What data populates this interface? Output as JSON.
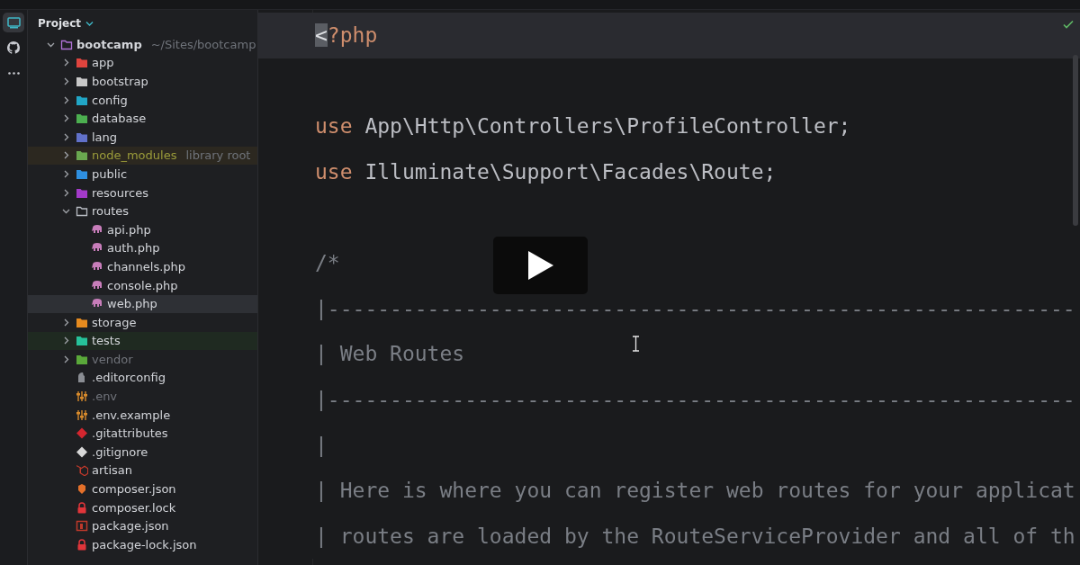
{
  "toolbar": [
    {
      "kind": "monitor",
      "selected": true
    },
    {
      "kind": "github",
      "selected": false
    },
    {
      "kind": "more",
      "selected": false
    }
  ],
  "sidebar": {
    "title": "Project",
    "tree": [
      {
        "label": "bootcamp",
        "path": "~/Sites/bootcamp",
        "kind": "folder-outline",
        "color": "#b072d6",
        "expanded": true,
        "selected": false,
        "children": [
          {
            "label": "app",
            "kind": "folder",
            "color": "#e0443e",
            "expanded": false,
            "selected": false
          },
          {
            "label": "bootstrap",
            "kind": "folder",
            "color": "#c8c8c8",
            "expanded": false,
            "selected": false
          },
          {
            "label": "config",
            "kind": "folder",
            "color": "#21a6c6",
            "expanded": false,
            "selected": false
          },
          {
            "label": "database",
            "kind": "folder",
            "color": "#4caf50",
            "expanded": false,
            "selected": false
          },
          {
            "label": "lang",
            "kind": "folder",
            "color": "#6171c9",
            "expanded": false,
            "selected": false
          },
          {
            "label": "node_modules",
            "note": "library root",
            "kind": "library-folder",
            "color": "#6aa84f",
            "expanded": false,
            "selected": false
          },
          {
            "label": "public",
            "kind": "folder",
            "color": "#2e8fe0",
            "expanded": false,
            "selected": false
          },
          {
            "label": "resources",
            "kind": "folder",
            "color": "#a33ac9",
            "expanded": false,
            "selected": false
          },
          {
            "label": "routes",
            "kind": "folder-outline",
            "color": "#b8bcc4",
            "expanded": true,
            "selected": false,
            "children": [
              {
                "label": "api.php",
                "kind": "php",
                "color": "#c77dba",
                "selected": false
              },
              {
                "label": "auth.php",
                "kind": "php",
                "color": "#c77dba",
                "selected": false
              },
              {
                "label": "channels.php",
                "kind": "php",
                "color": "#c77dba",
                "selected": false
              },
              {
                "label": "console.php",
                "kind": "php",
                "color": "#c77dba",
                "selected": false
              },
              {
                "label": "web.php",
                "kind": "php",
                "color": "#c77dba",
                "selected": true
              }
            ]
          },
          {
            "label": "storage",
            "kind": "folder",
            "color": "#e68a1f",
            "expanded": false,
            "selected": false
          },
          {
            "label": "tests",
            "kind": "test-folder",
            "color": "#26c29a",
            "expanded": false,
            "selected": false
          },
          {
            "label": "vendor",
            "kind": "excluded-folder",
            "color": "#5aa83a",
            "expanded": false,
            "selected": false
          },
          {
            "label": ".editorconfig",
            "kind": "config-file",
            "color": "#8a8d93",
            "selected": false
          },
          {
            "label": ".env",
            "kind": "ignored-env",
            "color": "#d98b2b",
            "selected": false
          },
          {
            "label": ".env.example",
            "kind": "env",
            "color": "#d98b2b",
            "selected": false
          },
          {
            "label": ".gitattributes",
            "kind": "git",
            "color": "#d4262f",
            "selected": false
          },
          {
            "label": ".gitignore",
            "kind": "git",
            "color": "#d8d8d8",
            "selected": false
          },
          {
            "label": "artisan",
            "kind": "laravel",
            "color": "#c0392b",
            "selected": false
          },
          {
            "label": "composer.json",
            "kind": "composer",
            "color": "#e4702a",
            "selected": false
          },
          {
            "label": "composer.lock",
            "kind": "lock",
            "color": "#e0353a",
            "selected": false
          },
          {
            "label": "package.json",
            "kind": "npm",
            "color": "#c0392b",
            "selected": false
          },
          {
            "label": "package-lock.json",
            "kind": "lock",
            "color": "#e0353a",
            "selected": false
          }
        ]
      }
    ]
  },
  "editor": {
    "lines": [
      {
        "current": true,
        "tokens": [
          {
            "kind": "caret",
            "text": "<"
          },
          {
            "kind": "keyword",
            "text": "?php"
          }
        ]
      },
      {
        "current": false
      },
      {
        "current": false,
        "tokens": [
          {
            "kind": "keyword",
            "text": "use"
          },
          {
            "kind": "plain",
            "text": " App\\Http\\Controllers\\ProfileController;"
          }
        ]
      },
      {
        "current": false,
        "tokens": [
          {
            "kind": "keyword",
            "text": "use"
          },
          {
            "kind": "plain",
            "text": " Illuminate\\Support\\Facades\\Route;"
          }
        ]
      },
      {
        "current": false
      },
      {
        "current": false,
        "tokens": [
          {
            "kind": "comment",
            "text": "/*"
          }
        ]
      },
      {
        "current": false,
        "tokens": [
          {
            "kind": "comment",
            "text": "|------------------------------------------------------------"
          }
        ]
      },
      {
        "current": false,
        "tokens": [
          {
            "kind": "comment",
            "text": "| Web Routes"
          }
        ]
      },
      {
        "current": false,
        "tokens": [
          {
            "kind": "comment",
            "text": "|------------------------------------------------------------"
          }
        ]
      },
      {
        "current": false,
        "tokens": [
          {
            "kind": "comment",
            "text": "|"
          }
        ]
      },
      {
        "current": false,
        "tokens": [
          {
            "kind": "comment",
            "text": "| Here is where you can register web routes for your applicat"
          }
        ]
      },
      {
        "current": false,
        "tokens": [
          {
            "kind": "comment",
            "text": "| routes are loaded by the RouteServiceProvider and all of th"
          }
        ]
      }
    ]
  },
  "overlay": {
    "kind": "play"
  }
}
